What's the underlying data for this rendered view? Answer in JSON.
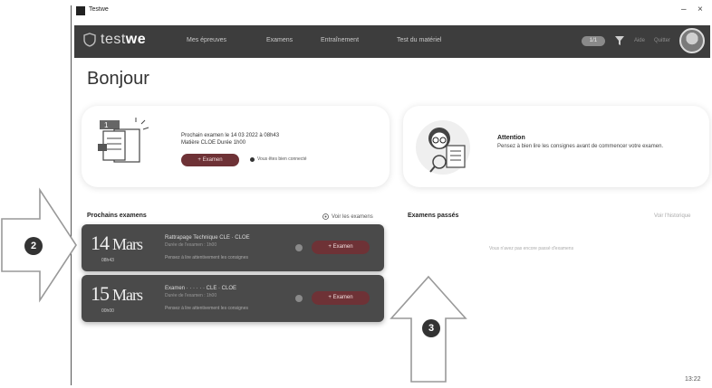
{
  "window": {
    "app_name": "Testwe",
    "minimize": "–",
    "close": "×"
  },
  "navbar": {
    "brand_light": "test",
    "brand_bold": "we",
    "items": [
      {
        "label": "Mes épreuves"
      },
      {
        "label": "Examens"
      },
      {
        "label": "Entraînement"
      },
      {
        "label": "Test du matériel"
      }
    ],
    "credit": "1/1",
    "aide": "Aide",
    "quitter": "Quitter"
  },
  "greeting": "Bonjour",
  "next_exam": {
    "line1": "Prochain examen le 14 03 2022 à 08h43",
    "line2": "Matière CLOE Durée 1h00",
    "button": "Examen",
    "network": "Vous êtes bien connecté"
  },
  "attention": {
    "title": "Attention",
    "text": "Pensez à bien lire les consignes avant de commencer votre examen."
  },
  "upcoming": {
    "title": "Prochains examens",
    "see_all": "Voir les examens",
    "rows": [
      {
        "day": "14",
        "month": "Mars",
        "time": "08h43",
        "title": "Rattrapage Technique CLE · CLOE",
        "sub": "Durée de l'examen : 1h00",
        "meta": "Pensez à lire attentivement les consignes",
        "button": "Examen"
      },
      {
        "day": "15",
        "month": "Mars",
        "time": "00h00",
        "title": "Examen · · · · · · CLE · CLOE",
        "sub": "Durée de l'examen : 1h00",
        "meta": "Pensez à lire attentivement les consignes",
        "button": "Examen"
      }
    ]
  },
  "past": {
    "title": "Examens passés",
    "see_all": "Voir l'historique",
    "empty": "Vous n'avez pas encore passé d'examens"
  },
  "annotations": {
    "badge_a": "2",
    "badge_b": "3"
  },
  "clock": "13:22",
  "colors": {
    "navbar": "#3d3d3d",
    "accent_button": "#6e3236",
    "exam_row": "#4a4a4a"
  }
}
